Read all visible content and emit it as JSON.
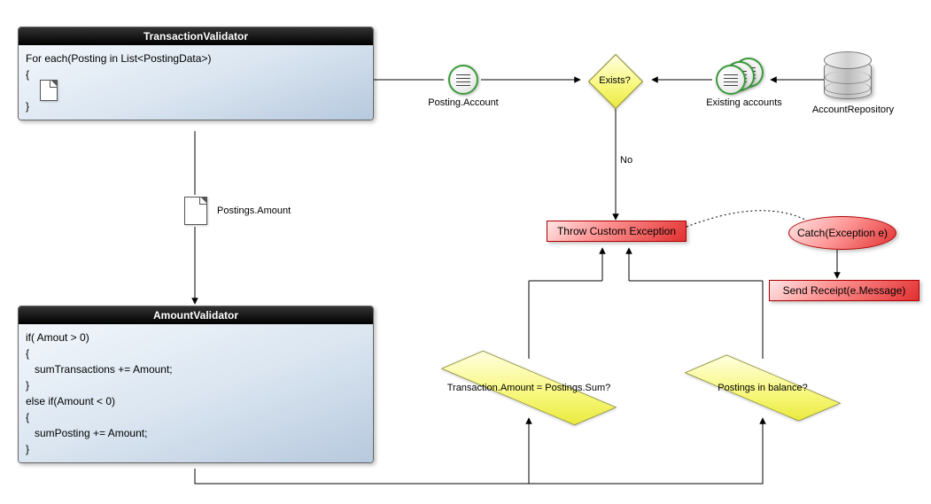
{
  "nodes": {
    "transactionValidator": {
      "title": "TransactionValidator",
      "code": "For each(Posting in List<PostingData>)\n{\n\n}"
    },
    "amountValidator": {
      "title": "AmountValidator",
      "code": "if( Amout > 0)\n{\n   sumTransactions += Amount;\n}\nelse if(Amount < 0)\n{\n   sumPosting += Amount;\n}"
    },
    "postingAccount": {
      "label": "Posting.Account"
    },
    "existingAccounts": {
      "label": "Existing accounts"
    },
    "accountRepository": {
      "label": "AccountRepository"
    },
    "postingsAmount": {
      "label": "Postings.Amount"
    },
    "existsDecision": {
      "label": "Exists?"
    },
    "existsNo": {
      "label": "No"
    },
    "sumDecision": {
      "label": "Transaction.Amount = Postings.Sum?"
    },
    "balanceDecision": {
      "label": "Postings in balance?"
    },
    "throwException": {
      "label": "Throw Custom Exception"
    },
    "catchBlock": {
      "label": "Catch(Exception e)"
    },
    "sendReceipt": {
      "label": "Send Receipt(e.Message)"
    }
  },
  "edges": [
    {
      "from": "transactionValidator",
      "to": "postingAccount"
    },
    {
      "from": "postingAccount",
      "to": "existsDecision"
    },
    {
      "from": "existingAccounts",
      "to": "existsDecision"
    },
    {
      "from": "accountRepository",
      "to": "existingAccounts"
    },
    {
      "from": "existsDecision",
      "to": "throwException",
      "label": "No"
    },
    {
      "from": "transactionValidator",
      "to": "amountValidator",
      "via": "postingsAmount"
    },
    {
      "from": "amountValidator",
      "to": "sumDecision"
    },
    {
      "from": "amountValidator",
      "to": "balanceDecision"
    },
    {
      "from": "sumDecision",
      "to": "throwException"
    },
    {
      "from": "balanceDecision",
      "to": "throwException"
    },
    {
      "from": "throwException",
      "to": "catchBlock",
      "style": "dotted"
    },
    {
      "from": "catchBlock",
      "to": "sendReceipt"
    }
  ]
}
